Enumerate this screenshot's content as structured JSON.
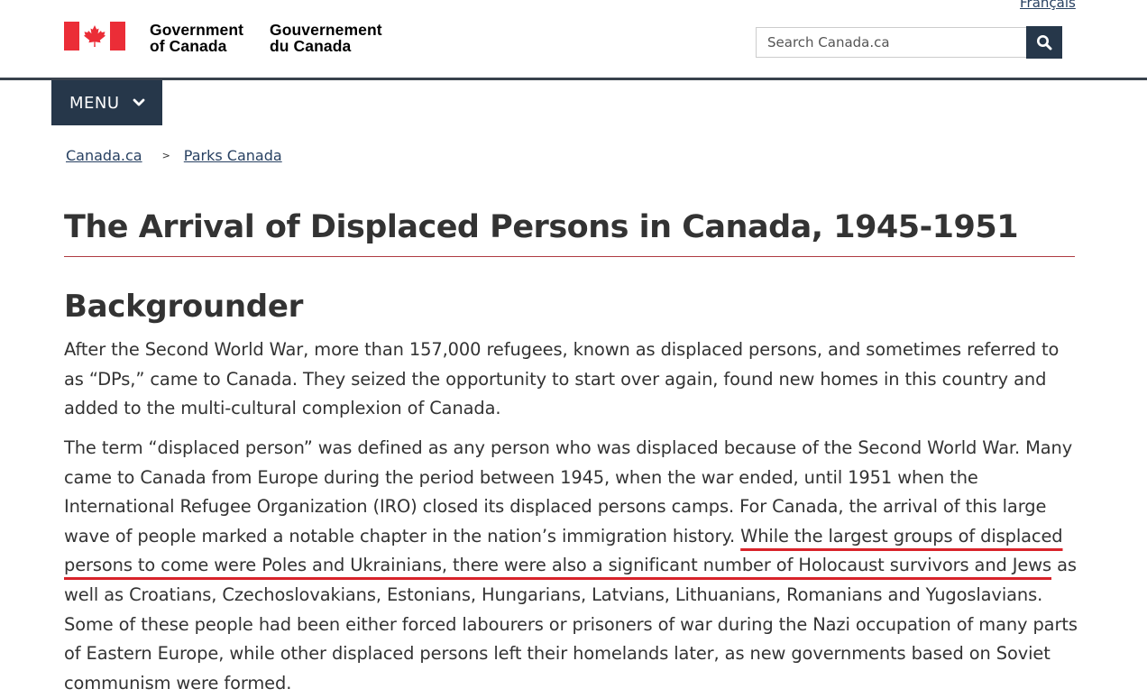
{
  "header": {
    "language_link": "Français",
    "wordmark_en": [
      "Government",
      "of Canada"
    ],
    "wordmark_fr": [
      "Gouvernement",
      "du Canada"
    ],
    "flag_icon": "canada-flag-icon",
    "search": {
      "placeholder": "Search Canada.ca",
      "value": "",
      "button_icon": "search-icon"
    }
  },
  "menu": {
    "label": "MENU",
    "icon": "chevron-down-icon"
  },
  "breadcrumb": {
    "items": [
      "Canada.ca",
      "Parks Canada"
    ],
    "separator": ">"
  },
  "main": {
    "title": "The Arrival of Displaced Persons in Canada, 1945-1951",
    "section_heading": "Backgrounder",
    "paragraph1": "After the Second World War, more than 157,000 refugees, known as displaced persons, and sometimes referred to as “DPs,” came to Canada. They seized the opportunity to start over again, found new homes in this country and added to the multi-cultural complexion of Canada.",
    "paragraph2_before": "The term “displaced person” was defined as any person who was displaced because of the Second World War. Many came to Canada from Europe during the period between 1945, when the war ended, until 1951 when the International Refugee Organization (IRO) closed its displaced persons camps. For Canada, the arrival of this large wave of people marked a notable chapter in the nation’s immigration history. ",
    "paragraph2_highlight": "While the largest groups of displaced persons to come were Poles and Ukrainians, there were also a significant number of Holocaust survivors and Jews",
    "paragraph2_after": " as well as Croatians, Czechoslovakians, Estonians, Hungarians, Latvians, Lithuanians, Romanians and Yugoslavians. Some of these people had been either forced labourers or prisoners of war during the Nazi occupation of many parts of Eastern Europe, while other displaced persons left their homelands later, as new governments based on Soviet communism were formed."
  },
  "colors": {
    "header_dark": "#26374a",
    "link": "#284162",
    "title_rule": "#af3c43",
    "annotation_underline": "#d8232a",
    "flag_red": "#eb2d37"
  }
}
